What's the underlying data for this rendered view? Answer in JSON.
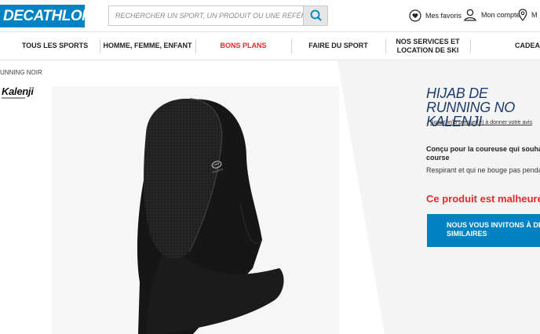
{
  "header": {
    "logo_text": "DECATHLON",
    "search_placeholder": "RECHERCHER UN SPORT, UN PRODUIT OU UNE RÉFÉRENCE",
    "favorites_label": "Mes favoris",
    "account_label": "Mon compte",
    "stores_label": "M"
  },
  "nav": {
    "items": [
      {
        "label": "TOUS LES SPORTS"
      },
      {
        "label": "HOMME, FEMME, ENFANT"
      },
      {
        "label": "BONS PLANS"
      },
      {
        "label": "FAIRE DU SPORT"
      },
      {
        "label": "NOS SERVICES ET LOCATION DE SKI"
      },
      {
        "label": "CADEAU"
      }
    ]
  },
  "breadcrumb": "UNNING NOIR",
  "brand": "Kalenji",
  "product": {
    "brand_on_item": "KALENJI",
    "title": "HIJAB DE RUNNING NO KALENJI",
    "review_link": "Soyez le/la premier(e) à donner votre avis",
    "headline": "Conçu pour la coureuse qui souhaite course",
    "description": "Respirant et qui ne bouge pas penda",
    "unavailable": "Ce produit est malheureus",
    "cta_label": "NOUS VOUS INVITONS À DÉC SIMILAIRES"
  },
  "colors": {
    "brand_blue": "#0082c3",
    "deal_red": "#e22b2b",
    "title_navy": "#1d3c6f"
  },
  "icons": {
    "search": "search-icon",
    "favorites": "heart-circle-icon",
    "account": "user-icon",
    "stores": "location-pin-icon"
  }
}
